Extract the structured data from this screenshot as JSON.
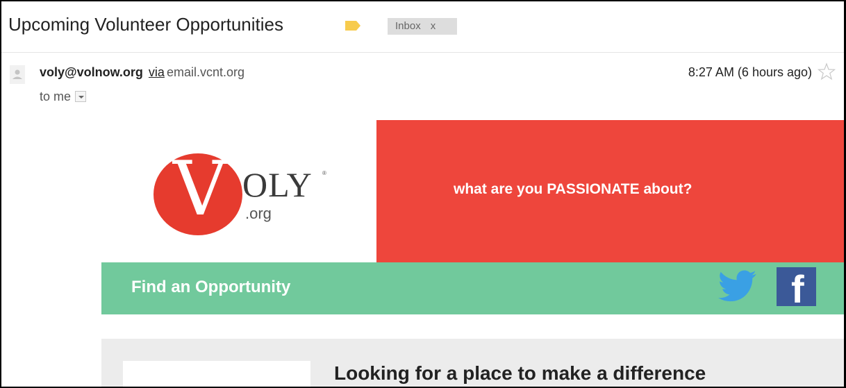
{
  "subject": {
    "title": "Upcoming Volunteer Opportunities",
    "label_icon": "label-tag-icon",
    "label_color": "#f7cb4d",
    "inbox_label": "Inbox",
    "inbox_remove": "x"
  },
  "message": {
    "sender_email": "voly@volnow.org",
    "via_label": "via",
    "via_domain": "email.vcnt.org",
    "recipient": "to me",
    "time": "8:27 AM (6 hours ago)",
    "star_icon": "star-icon"
  },
  "email_body": {
    "logo": {
      "letter": "V",
      "name": "OLY",
      "registered": "®",
      "suffix": ".org",
      "color": "#e63b2e"
    },
    "banner_text": "what are you PASSIONATE about?",
    "banner_color": "#ee463c",
    "nav_label": "Find an Opportunity",
    "nav_color": "#71c99c",
    "social_icons": [
      "twitter-icon",
      "facebook-icon"
    ],
    "facebook_glyph": "f",
    "headline": "Looking for a place to make a difference"
  }
}
